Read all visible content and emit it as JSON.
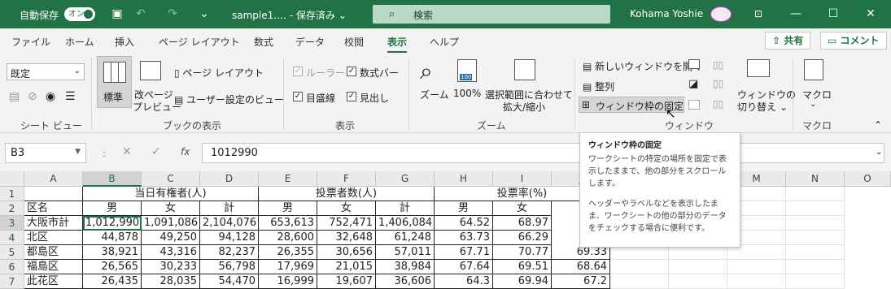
{
  "titlebar": {
    "autosave_label": "自動保存",
    "autosave_toggle": "オン",
    "filename": "sample1.… - 保存済み ⌄",
    "search_placeholder": "検索",
    "user": "Kohama Yoshie"
  },
  "tabs": [
    "ファイル",
    "ホーム",
    "挿入",
    "ページ レイアウト",
    "数式",
    "データ",
    "校閲",
    "表示",
    "ヘルプ"
  ],
  "active_tab": "表示",
  "share_label": "共有",
  "comment_label": "コメント",
  "ribbon": {
    "sheetview_select": "既定",
    "sheetview_group": "シート ビュー",
    "normal": "標準",
    "pagebreak": "改ページ",
    "pagebreak2": "プレビュー",
    "pagelayout": "ページ レイアウト",
    "customview": "ユーザー設定のビュー",
    "bookview_group": "ブックの表示",
    "ruler": "ルーラー",
    "formulabar": "数式バー",
    "gridlines": "目盛線",
    "headings": "見出し",
    "show_group": "表示",
    "zoom": "ズーム",
    "zoom100": "100%",
    "zoomsel": "選択範囲に合わせて",
    "zoomsel2": "拡大/縮小",
    "zoom_group": "ズーム",
    "newwindow": "新しいウィンドウを開く",
    "arrange": "整列",
    "freeze": "ウィンドウ枠の固定 ⌄",
    "switch1": "ウィンドウの",
    "switch2": "切り替え ⌄",
    "window_group": "ウィンドウ",
    "macro": "マクロ",
    "macro_group": "マクロ"
  },
  "formula": {
    "namebox": "B3",
    "value": "1012990",
    "fx": "fx"
  },
  "columns": [
    "A",
    "B",
    "C",
    "D",
    "E",
    "F",
    "G",
    "H",
    "I",
    "J",
    "K",
    "L",
    "M",
    "N",
    "O"
  ],
  "rows": [
    "1",
    "2",
    "3",
    "4",
    "5",
    "6",
    "7"
  ],
  "sheet": {
    "r1": [
      "当日有権者(人)",
      "投票者数(人)",
      "投票率(%)"
    ],
    "r2": [
      "区名",
      "男",
      "女",
      "計",
      "男",
      "女",
      "計",
      "男",
      "女"
    ],
    "data": [
      [
        "大阪市計",
        "1,012,990",
        "1,091,086",
        "2,104,076",
        "653,613",
        "752,471",
        "1,406,084",
        "64.52",
        "68.97"
      ],
      [
        "北区",
        "44,878",
        "49,250",
        "94,128",
        "28,600",
        "32,648",
        "61,248",
        "63.73",
        "66.29"
      ],
      [
        "都島区",
        "38,921",
        "43,316",
        "82,237",
        "26,355",
        "30,656",
        "57,011",
        "67.71",
        "70.77"
      ],
      [
        "福島区",
        "26,565",
        "30,233",
        "56,798",
        "17,969",
        "21,015",
        "38,984",
        "67.64",
        "69.51"
      ],
      [
        "此花区",
        "26,435",
        "28,035",
        "54,470",
        "16,999",
        "19,607",
        "36,606",
        "64.3",
        "69.94"
      ]
    ],
    "j_visible": [
      "69.33",
      "68.64",
      "67.2"
    ]
  },
  "tooltip": {
    "title": "ウィンドウ枠の固定",
    "p1": "ワークシートの特定の場所を固定で表示したままで、他の部分をスクロールします。",
    "p2": "ヘッダーやラベルなどを表示したまま、ワークシートの他の部分のデータをチェックする場合に便利です。"
  }
}
